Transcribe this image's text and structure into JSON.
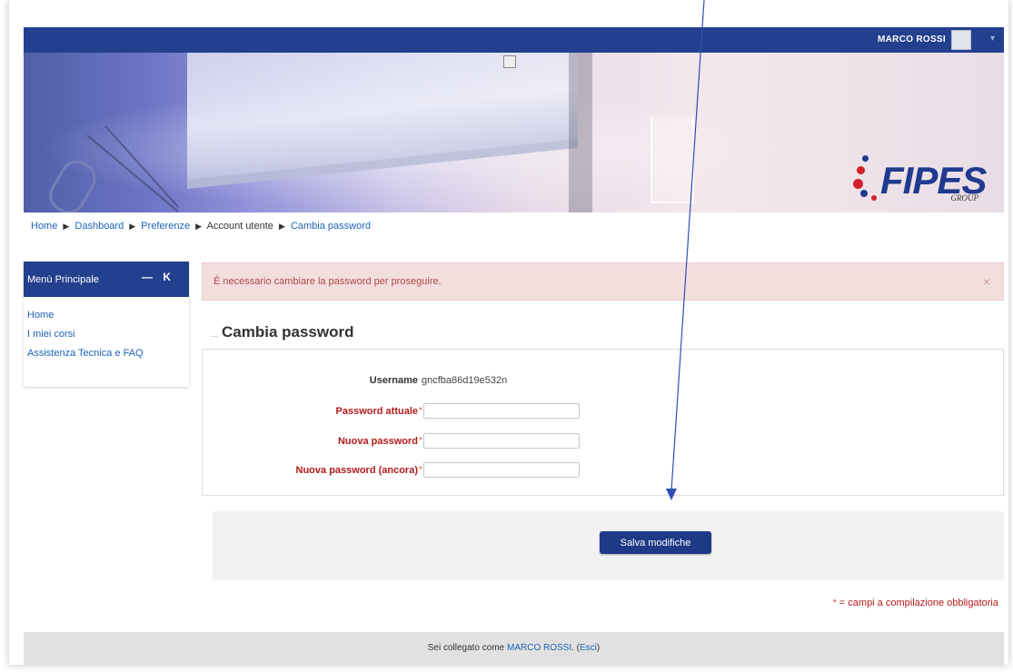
{
  "header": {
    "user_name": "MARCO ROSSI"
  },
  "logo": {
    "text": "FIPES",
    "sub": "GROUP"
  },
  "breadcrumb": {
    "home": "Home",
    "dashboard": "Dashboard",
    "preferences": "Preferenze",
    "account": "Account utente",
    "current": "Cambia password"
  },
  "sidebar": {
    "title": "Menù Principale",
    "controls": "— K",
    "items": [
      "Home",
      "I miei corsi",
      "Assistenza Tecnica e FAQ"
    ]
  },
  "alert": {
    "message": "È necessario cambiare la password per proseguire.",
    "close": "×"
  },
  "form": {
    "legend": "Cambia password",
    "username_label": "Username",
    "username_value": "gncfba86d19e532n",
    "current_password_label": "Password attuale",
    "new_password_label": "Nuova password",
    "new_password_again_label": "Nuova password (ancora)",
    "required_marker": "*",
    "save_label": "Salva modifiche"
  },
  "required_note": {
    "star": "*",
    "text": " = campi a compilazione obbligatoria"
  },
  "footer": {
    "prefix": "Sei collegato come ",
    "user_link": "MARCO ROSSI",
    "paren_open": ". (",
    "logout": "Esci",
    "paren_close": ")"
  },
  "colors": {
    "brand_blue": "#23408e",
    "link_blue": "#1e63b6",
    "required_red": "#b31b1b",
    "alert_bg": "#f3dede"
  }
}
